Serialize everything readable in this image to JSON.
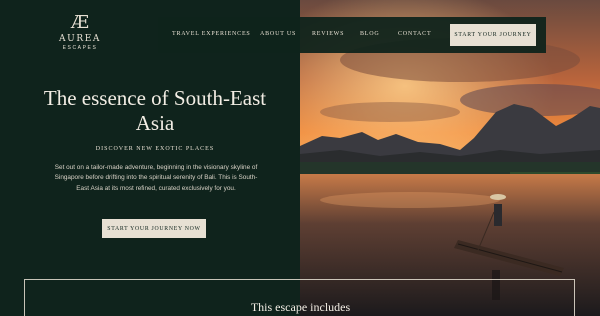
{
  "logo": {
    "mark": "Æ",
    "name": "AUREA",
    "sub": "ESCAPES"
  },
  "nav": {
    "items": [
      "TRAVEL EXPERIENCES",
      "ABOUT US",
      "REVIEWS",
      "BLOG",
      "CONTACT"
    ],
    "cta": "START YOUR JOURNEY"
  },
  "hero": {
    "title": "The essence of South-East Asia",
    "subtitle": "DISCOVER NEW EXOTIC PLACES",
    "body": "Set out on a tailor-made adventure, beginning in the visionary skyline of Singapore before drifting into the spiritual serenity of Bali. This is South-East Asia at its most refined, curated exclusively for you.",
    "cta": "START YOUR JOURNEY NOW"
  },
  "includes": {
    "title": "This escape includes"
  },
  "colors": {
    "panel": "#0f231c",
    "cream": "#e7e0d3",
    "sunset_orange": "#f08a3c"
  },
  "icons": {
    "photo": "river-sunset-photo"
  }
}
